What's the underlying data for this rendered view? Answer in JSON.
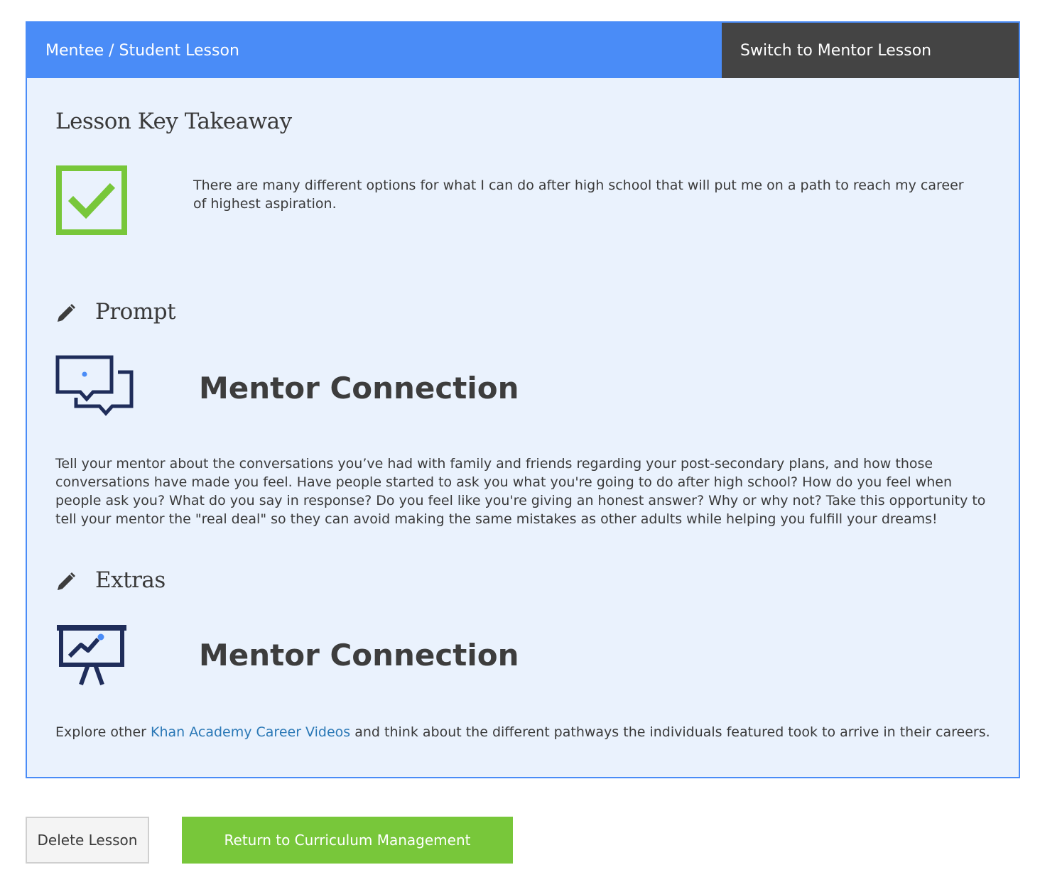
{
  "header": {
    "title": "Mentee / Student Lesson",
    "switch_label": "Switch to Mentor Lesson"
  },
  "takeaway": {
    "heading": "Lesson Key Takeaway",
    "text": "There are many different options for what I can do after high school that will put me on a path to reach my career of highest aspiration."
  },
  "prompt": {
    "heading": "Prompt",
    "title": "Mentor Connection",
    "body": "Tell your mentor about the conversations you’ve had with family and friends regarding your post-secondary plans, and how those conversations have made you feel. Have people started to ask you what you're going to do after high school? How do you feel when people ask you? What do you say in response? Do you feel like you're giving an honest answer? Why or why not? Take this opportunity to tell your mentor the \"real deal\" so they can avoid making the same mistakes as other adults while helping you fulfill your dreams!"
  },
  "extras": {
    "heading": "Extras",
    "title": "Mentor Connection",
    "body_before": "Explore other ",
    "link_text": "Khan Academy Career Videos",
    "body_after": " and think about the different pathways the individuals featured took to arrive in their careers."
  },
  "actions": {
    "delete_label": "Delete Lesson",
    "return_label": "Return to Curriculum Management"
  },
  "icons": {
    "takeaway": "checkmark-box-icon",
    "pencil": "pencil-icon",
    "prompt": "chat-bubbles-icon",
    "extras": "presentation-board-icon"
  },
  "colors": {
    "accent_blue": "#4a8cf7",
    "header_dark": "#444444",
    "panel_bg": "#eaf2fd",
    "success_green": "#78c73a",
    "icon_navy": "#1f2d5a",
    "link_blue": "#2a78b6"
  }
}
